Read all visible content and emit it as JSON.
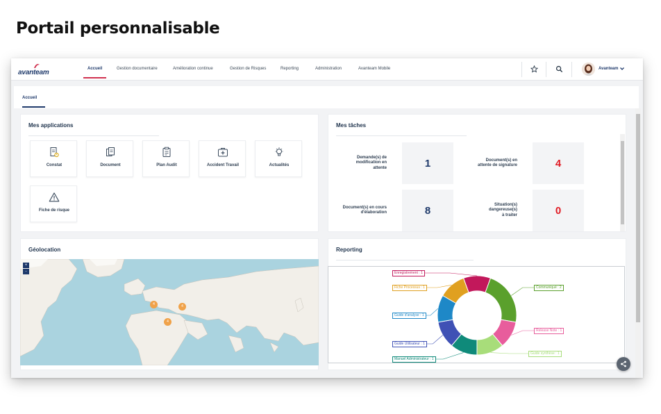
{
  "page_heading": "Portail personnalisable",
  "app": {
    "logo_text": "avanteam",
    "nav": [
      {
        "label": "Accueil",
        "active": true
      },
      {
        "label": "Gestion documentaire"
      },
      {
        "label": "Amélioration continue"
      },
      {
        "label": "Gestion de Risques"
      },
      {
        "label": "Reporting"
      },
      {
        "label": "Administration"
      },
      {
        "label": "Avanteam Mobile"
      }
    ],
    "icons": {
      "favorite": "star-icon",
      "search": "search-icon",
      "user_menu": "chevron-down-icon"
    },
    "user": {
      "name": "Avanteam"
    },
    "accent_color": "#d0314f",
    "brand_color": "#1f3a6b"
  },
  "tabs": [
    {
      "label": "Accueil",
      "active": true
    }
  ],
  "applications": {
    "title": "Mes applications",
    "items": [
      {
        "label": "Constat",
        "icon": "constat-icon"
      },
      {
        "label": "Document",
        "icon": "document-icon"
      },
      {
        "label": "Plan Audit",
        "icon": "clipboard-icon"
      },
      {
        "label": "Accident Travail",
        "icon": "first-aid-icon"
      },
      {
        "label": "Actualités",
        "icon": "lightbulb-icon"
      },
      {
        "label": "Fiche de risque",
        "icon": "warning-icon"
      }
    ]
  },
  "tasks": {
    "title": "Mes tâches",
    "items": [
      {
        "label_lines": [
          "Demande(s) de",
          "modification en",
          "attente"
        ],
        "count": "1",
        "color": "#1f3a6b"
      },
      {
        "label_lines": [
          "Document(s) en",
          "attente de signature"
        ],
        "count": "4",
        "color": "#e01b24"
      },
      {
        "label_lines": [
          "Document(s) en cours",
          "d'élaboration"
        ],
        "count": "8",
        "color": "#1f3a6b"
      },
      {
        "label_lines": [
          "Situation(s)",
          "dangereuse(s)",
          "à traiter"
        ],
        "count": "0",
        "color": "#e01b24"
      }
    ]
  },
  "geolocation": {
    "title": "Géolocation",
    "zoom_in": "+",
    "zoom_out": "-",
    "markers": [
      "4",
      "4",
      "4"
    ]
  },
  "reporting": {
    "title": "Reporting",
    "chart_data": {
      "type": "pie",
      "donut": true,
      "labels": [
        "Enregistrement : 1",
        "Communiqué : 2",
        "Release Note : 1",
        "Guide synthèse : 1",
        "Manuel Administrateur : 1",
        "Guide Utilisateur : 1",
        "Guide d'analyse : 1",
        "Fiche Processus : 1"
      ],
      "values": [
        2,
        4,
        2,
        2,
        2,
        2,
        2,
        2
      ],
      "colors": [
        "#c2185b",
        "#5aa02c",
        "#e85d9c",
        "#a8dd7a",
        "#0f8a7a",
        "#3f51b5",
        "#1e88c7",
        "#e0a020"
      ],
      "label_texts": [
        "Enregistrement : 1",
        "Communiqué : 2",
        "Release Note : 1",
        "Guide synthèse : 1",
        "Manuel Administrateur : 1",
        "Guide Utilisateur : 1",
        "Guide d'analyse : 1",
        "Fiche Processus : 1"
      ]
    }
  },
  "fab_icon": "share-icon"
}
